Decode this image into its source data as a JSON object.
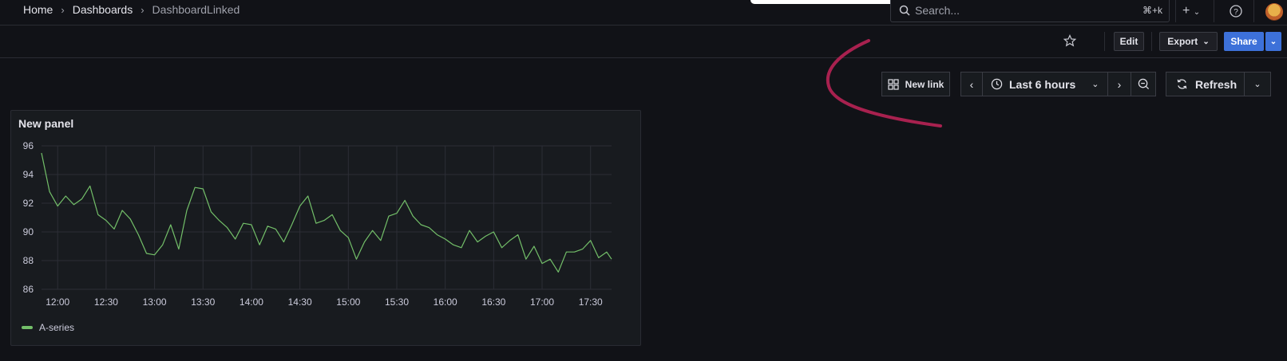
{
  "breadcrumb": {
    "home": "Home",
    "dashboards": "Dashboards",
    "current": "DashboardLinked"
  },
  "search": {
    "placeholder": "Search...",
    "shortcut": "⌘+k"
  },
  "toolbar": {
    "edit": "Edit",
    "export": "Export",
    "share": "Share"
  },
  "controls": {
    "new_link": "New link",
    "time_range": "Last 6 hours",
    "refresh": "Refresh"
  },
  "panel": {
    "title": "New panel"
  },
  "colors": {
    "series": "#73bf69",
    "annotation": "#a8214f",
    "accent": "#3d71d9"
  },
  "chart_data": {
    "type": "line",
    "ylim": [
      86,
      96
    ],
    "y_ticks": [
      "96",
      "94",
      "92",
      "90",
      "88",
      "86"
    ],
    "x_ticks": [
      "12:00",
      "12:30",
      "13:00",
      "13:30",
      "14:00",
      "14:30",
      "15:00",
      "15:30",
      "16:00",
      "16:30",
      "17:00",
      "17:30"
    ],
    "x_range": [
      "11:50",
      "17:43"
    ],
    "grid": true,
    "legend_position": "bottom-left",
    "series": [
      {
        "name": "A-series",
        "x": [
          "11:50",
          "11:55",
          "12:00",
          "12:05",
          "12:10",
          "12:15",
          "12:20",
          "12:25",
          "12:30",
          "12:35",
          "12:40",
          "12:45",
          "12:50",
          "12:55",
          "13:00",
          "13:05",
          "13:10",
          "13:15",
          "13:20",
          "13:25",
          "13:30",
          "13:35",
          "13:40",
          "13:45",
          "13:50",
          "13:55",
          "14:00",
          "14:05",
          "14:10",
          "14:15",
          "14:20",
          "14:25",
          "14:30",
          "14:35",
          "14:40",
          "14:45",
          "14:50",
          "14:55",
          "15:00",
          "15:05",
          "15:10",
          "15:15",
          "15:20",
          "15:25",
          "15:30",
          "15:35",
          "15:40",
          "15:45",
          "15:50",
          "15:55",
          "16:00",
          "16:05",
          "16:10",
          "16:15",
          "16:20",
          "16:25",
          "16:30",
          "16:35",
          "16:40",
          "16:45",
          "16:50",
          "16:55",
          "17:00",
          "17:05",
          "17:10",
          "17:15",
          "17:20",
          "17:25",
          "17:30",
          "17:35",
          "17:40",
          "17:43"
        ],
        "values": [
          95.5,
          92.8,
          91.8,
          92.5,
          91.9,
          92.3,
          93.2,
          91.2,
          90.8,
          90.2,
          91.5,
          90.9,
          89.8,
          88.5,
          88.4,
          89.1,
          90.5,
          88.8,
          91.5,
          93.1,
          93.0,
          91.4,
          90.8,
          90.3,
          89.5,
          90.6,
          90.5,
          89.1,
          90.4,
          90.2,
          89.3,
          90.5,
          91.8,
          92.5,
          90.6,
          90.8,
          91.2,
          90.1,
          89.6,
          88.1,
          89.3,
          90.1,
          89.4,
          91.1,
          91.3,
          92.2,
          91.1,
          90.5,
          90.3,
          89.8,
          89.5,
          89.1,
          88.9,
          90.1,
          89.3,
          89.7,
          90.0,
          88.9,
          89.4,
          89.8,
          88.1,
          89.0,
          87.8,
          88.1,
          87.2,
          88.6,
          88.6,
          88.8,
          89.4,
          88.2,
          88.6,
          88.1
        ]
      }
    ]
  }
}
